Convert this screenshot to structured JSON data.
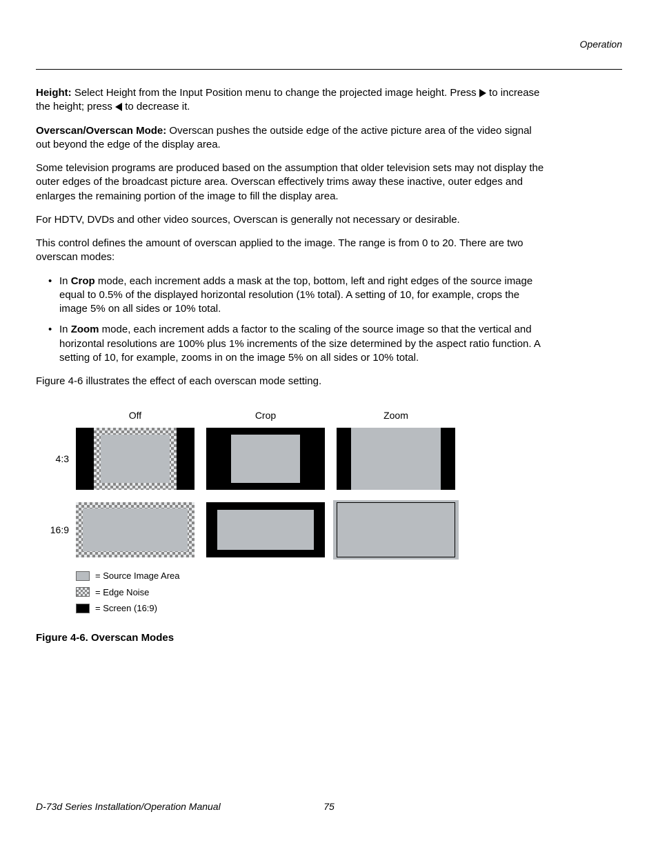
{
  "header": {
    "section": "Operation"
  },
  "para1": {
    "label": "Height:",
    "text_a": " Select Height from the Input Position menu to change the projected image height. Press ",
    "text_b": " to increase the height; press ",
    "text_c": " to decrease it."
  },
  "para2": {
    "label": "Overscan/Overscan Mode:",
    "text": " Overscan pushes the outside edge of the active picture area of the video signal out beyond the edge of the display area."
  },
  "para3": "Some television programs are produced based on the assumption that older television sets may not display the outer edges of the broadcast picture area. Overscan effectively trims away these inactive, outer edges and enlarges the remaining portion of the image to fill the display area.",
  "para4": "For HDTV, DVDs and other video sources, Overscan is generally not necessary or desirable.",
  "para5": "This control defines the amount of overscan applied to the image. The range is from 0 to 20. There are two overscan modes:",
  "bullet1": {
    "pre": "In ",
    "bold": "Crop",
    "post": " mode, each increment adds a mask at the top, bottom, left and right edges of the source image equal to 0.5% of the displayed horizontal resolution (1% total). A setting of 10, for example, crops the image 5% on all sides or 10% total."
  },
  "bullet2": {
    "pre": "In ",
    "bold": "Zoom",
    "post": " mode, each increment adds a factor to the scaling of the source image so that the vertical and horizontal resolutions are 100% plus 1% increments of the size determined by the aspect ratio function. A setting of 10, for example, zooms in on the image 5% on all sides or 10% total."
  },
  "para6": "Figure 4-6 illustrates the effect of each overscan mode setting.",
  "fig": {
    "cols": {
      "off": "Off",
      "crop": "Crop",
      "zoom": "Zoom"
    },
    "rows": {
      "r43": "4:3",
      "r169": "16:9"
    },
    "legend": {
      "src": "= Source Image Area",
      "noise": "= Edge Noise",
      "screen": "= Screen (16:9)"
    },
    "caption": "Figure 4-6. Overscan Modes"
  },
  "footer": {
    "title": "D-73d Series Installation/Operation Manual",
    "page": "75"
  }
}
